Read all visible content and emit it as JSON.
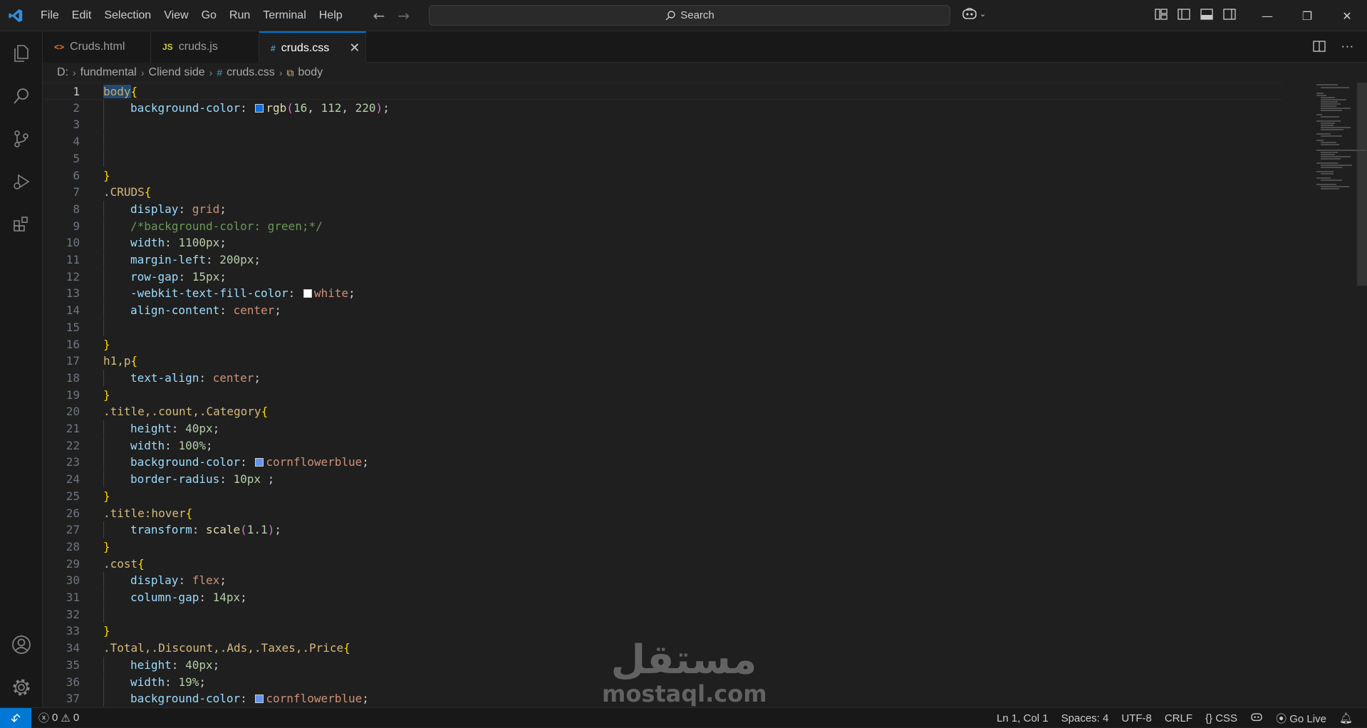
{
  "menu": [
    "File",
    "Edit",
    "Selection",
    "View",
    "Go",
    "Run",
    "Terminal",
    "Help"
  ],
  "search": {
    "label": "Search"
  },
  "tabs": [
    {
      "label": "Cruds.html",
      "icon": "<>"
    },
    {
      "label": "cruds.js",
      "icon": "JS"
    },
    {
      "label": "cruds.css",
      "icon": "#"
    }
  ],
  "breadcrumb": {
    "drive": "D:",
    "folder1": "fundmental",
    "folder2": "Cliend side",
    "file": "cruds.css",
    "symbol": "body"
  },
  "editor": {
    "lines": [
      "1",
      "2",
      "3",
      "4",
      "5",
      "6",
      "7",
      "8",
      "9",
      "10",
      "11",
      "12",
      "13",
      "14",
      "15",
      "16",
      "17",
      "18",
      "19",
      "20",
      "21",
      "22",
      "23",
      "24",
      "25",
      "26",
      "27",
      "28",
      "29",
      "30",
      "31",
      "32",
      "33",
      "34",
      "35",
      "36",
      "37"
    ],
    "code": {
      "l1_sel": "body",
      "l2_prop": "background-color",
      "l2_fn": "rgb",
      "l2_a": "16",
      "l2_b": "112",
      "l2_c": "220",
      "l7_sel": ".CRUDS",
      "l8_prop": "display",
      "l8_val": "grid",
      "l9_cmt": "/*background-color: green;*/",
      "l10_prop": "width",
      "l10_val": "1100px",
      "l11_prop": "margin-left",
      "l11_val": "200px",
      "l12_prop": "row-gap",
      "l12_val": "15px",
      "l13_prop": "-webkit-text-fill-color",
      "l13_val": "white",
      "l14_prop": "align-content",
      "l14_val": "center",
      "l17_sel": "h1,p",
      "l18_prop": "text-align",
      "l18_val": "center",
      "l20_sel": ".title,.count,.Category",
      "l21_prop": "height",
      "l21_val": "40px",
      "l22_prop": "width",
      "l22_val": "100%",
      "l23_prop": "background-color",
      "l23_val": "cornflowerblue",
      "l24_prop": "border-radius",
      "l24_val": "10px",
      "l26_sel": ".title:hover",
      "l27_prop": "transform",
      "l27_fn": "scale",
      "l27_arg": "1.1",
      "l29_sel": ".cost",
      "l30_prop": "display",
      "l30_val": "flex",
      "l31_prop": "column-gap",
      "l31_val": "14px",
      "l34_sel": ".Total,.Discount,.Ads,.Taxes,.Price",
      "l35_prop": "height",
      "l35_val": "40px",
      "l36_prop": "width",
      "l36_val": "19%",
      "l37_prop": "background-color",
      "l37_val": "cornflowerblue"
    }
  },
  "colors": {
    "rgb_swatch": "#1070dc",
    "white_swatch": "#ffffff",
    "cornflowerblue_swatch": "#6495ed",
    "accent": "#0078d4"
  },
  "watermark": {
    "arabic": "مستقل",
    "latin": "mostaql.com"
  },
  "status": {
    "errors": "0",
    "warnings": "0",
    "position": "Ln 1, Col 1",
    "spaces": "Spaces: 4",
    "encoding": "UTF-8",
    "eol": "CRLF",
    "language": "CSS",
    "golive": "Go Live"
  }
}
